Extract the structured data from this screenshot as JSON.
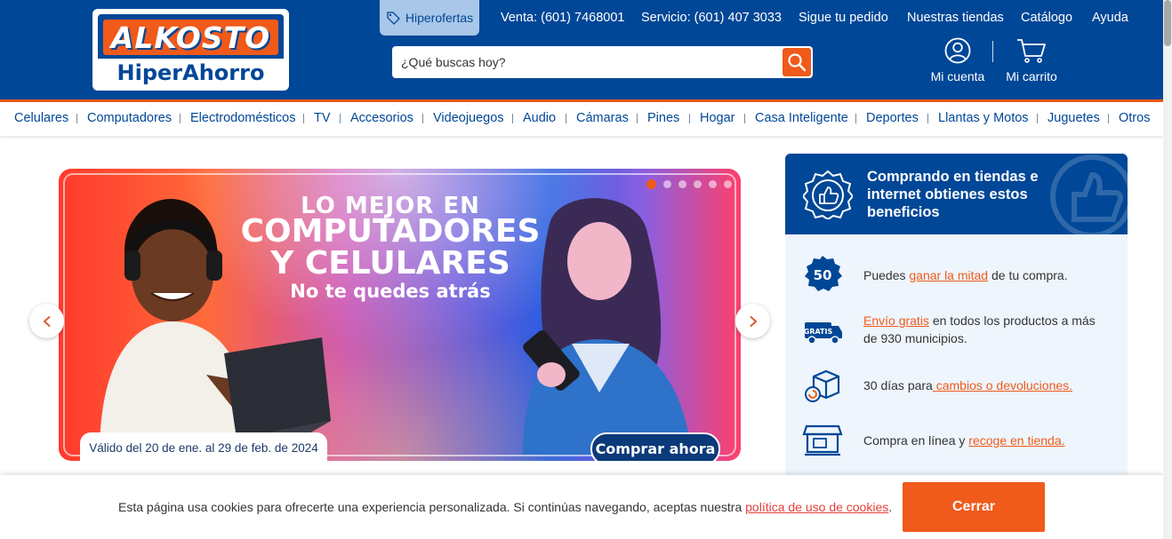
{
  "brand": {
    "logo_top": "ALKOSTO",
    "logo_bottom": "HiperAhorro",
    "primary_color": "#004797",
    "accent_color": "#f05a1a"
  },
  "header": {
    "hiperofertas": "Hiperofertas",
    "links": [
      "Venta: (601) 7468001",
      "Servicio: (601) 407 3033",
      "Sigue tu pedido",
      "Nuestras tiendas",
      "Catálogo",
      "Ayuda"
    ],
    "search_placeholder": "¿Qué buscas hoy?",
    "account_label": "Mi cuenta",
    "cart_label": "Mi carrito"
  },
  "categories": [
    "Celulares",
    "Computadores",
    "Electrodomésticos",
    "TV",
    "Accesorios",
    "Videojuegos",
    "Audio",
    "Cámaras",
    "Pines",
    "Hogar",
    "Casa Inteligente",
    "Deportes",
    "Llantas y Motos",
    "Juguetes",
    "Otros"
  ],
  "banner": {
    "title_line1": "LO MEJOR EN",
    "title_line2": "COMPUTADORES",
    "title_line3": "Y CELULARES",
    "subtitle": "No te quedes atrás",
    "validity": "Válido del 20 de ene. al 29 de feb. de 2024",
    "cta": "Comprar ahora",
    "slide_count": 6,
    "active_slide": 1
  },
  "benefits": {
    "title": "Comprando en tiendas e internet obtienes estos beneficios",
    "items": [
      {
        "icon": "half-price-icon",
        "before": "Puedes ",
        "link": "ganar la mitad",
        "after": " de tu compra."
      },
      {
        "icon": "free-shipping-truck-icon",
        "before": "",
        "link": "Envío gratis",
        "after": " en todos los productos a más de 930 municipios."
      },
      {
        "icon": "return-box-icon",
        "before": "30 días para",
        "link": " cambios o devoluciones.",
        "after": ""
      },
      {
        "icon": "store-pickup-icon",
        "before": "Compra en línea y ",
        "link": "recoge en tienda.",
        "after": ""
      }
    ]
  },
  "cookie": {
    "text": "Esta página usa cookies para ofrecerte una experiencia personalizada. Si continúas navegando, aceptas nuestra ",
    "link": "política de uso de cookies",
    "text_end": ".",
    "button": "Cerrar"
  }
}
